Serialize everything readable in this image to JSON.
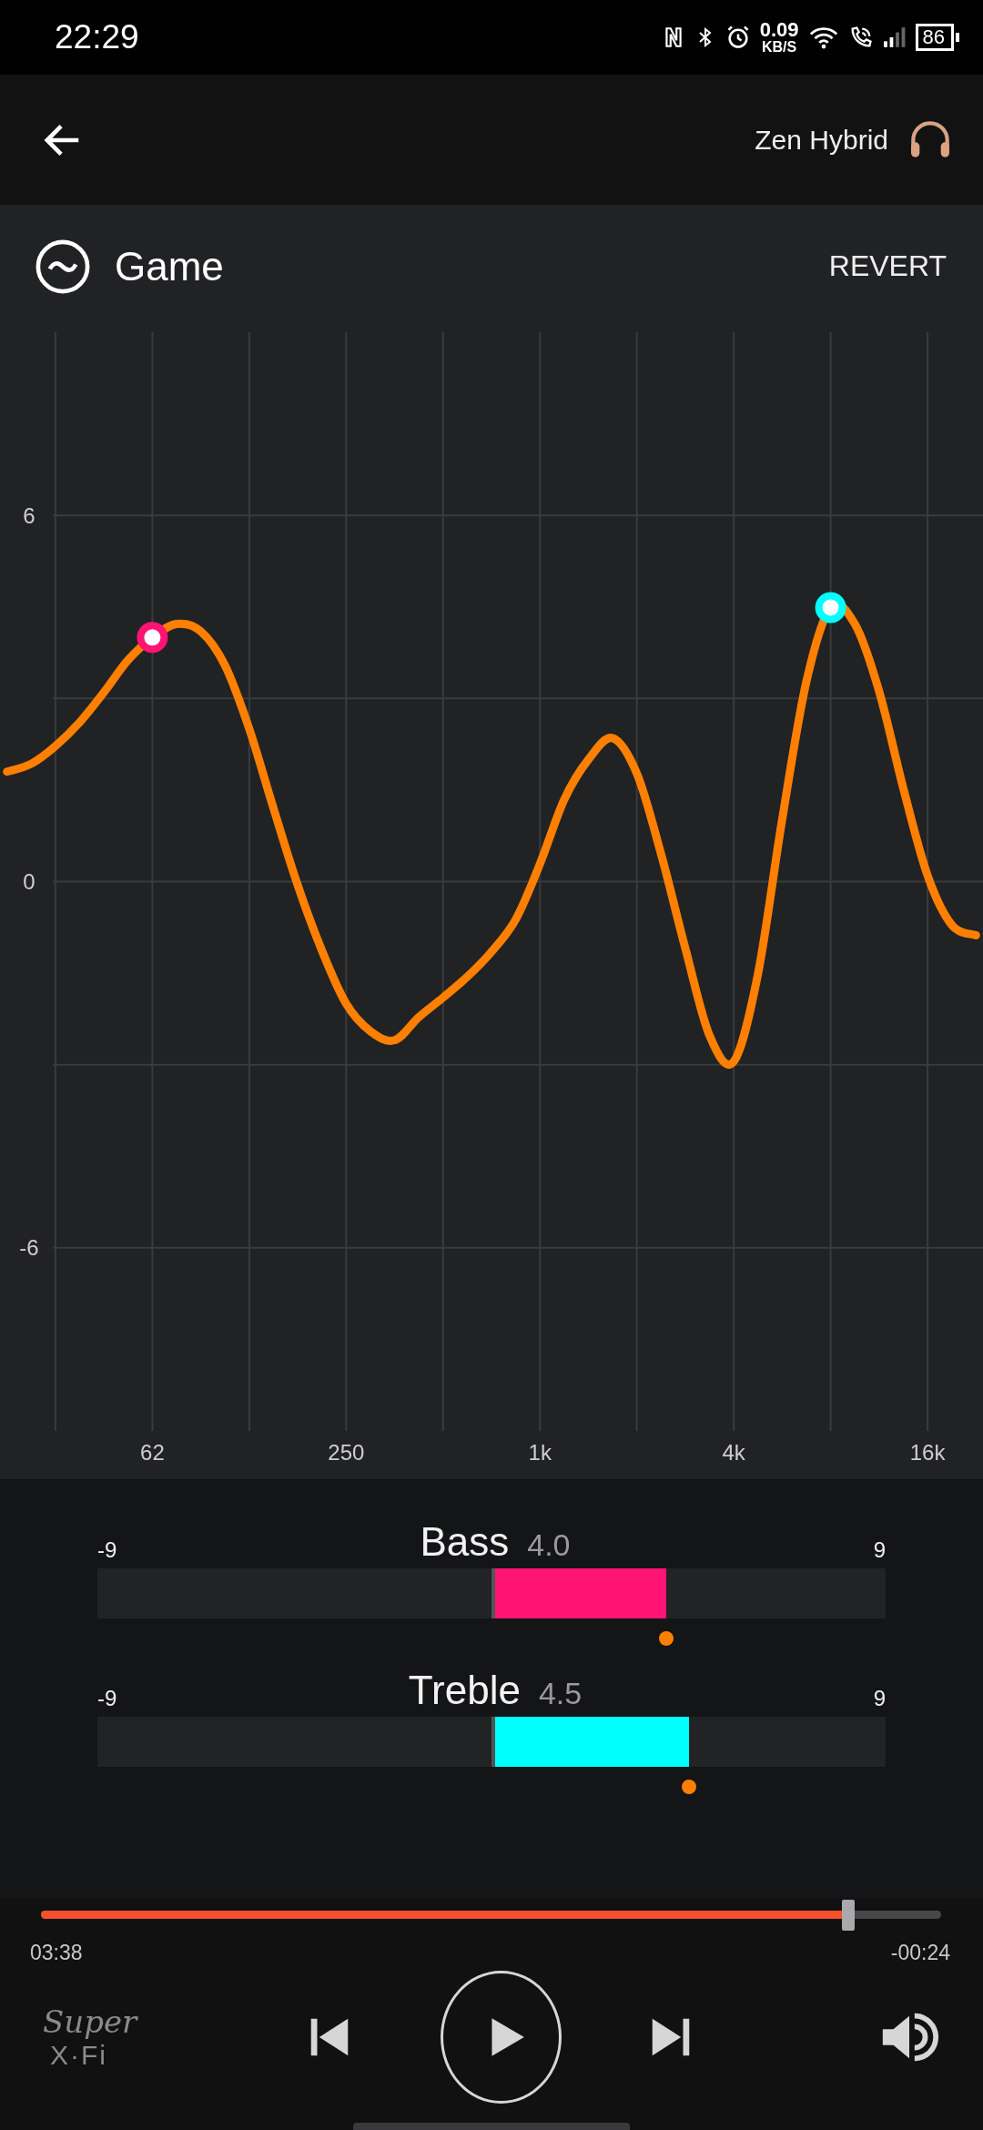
{
  "status_bar": {
    "time": "22:29",
    "net_speed": "0.09",
    "net_unit": "KB/S",
    "battery": "86"
  },
  "header": {
    "device": "Zen Hybrid"
  },
  "preset": {
    "name": "Game",
    "action": "REVERT"
  },
  "eq": {
    "chart_data": {
      "type": "line",
      "categories": [
        null,
        null,
        null,
        null,
        null,
        null,
        "62",
        null,
        null,
        null,
        null,
        null,
        null,
        null,
        "250",
        null,
        null,
        null,
        null,
        null,
        null,
        null,
        "1k",
        null,
        null,
        null,
        null,
        null,
        null,
        null,
        "4k",
        null,
        null,
        null,
        null,
        null,
        null,
        null,
        "16k",
        null,
        null
      ],
      "series": [
        {
          "color": "#ff7f00",
          "values": [
            1.8,
            1.93,
            2.22,
            2.61,
            3.1,
            3.63,
            4.0,
            4.22,
            4.1,
            3.54,
            2.5,
            1.2,
            -0.06,
            -1.13,
            -2.0,
            -2.45,
            -2.6,
            -2.22,
            -1.9,
            -1.56,
            -1.15,
            -0.62,
            0.29,
            1.34,
            2.0,
            2.35,
            1.77,
            0.45,
            -1.09,
            -2.52,
            -2.95,
            -1.51,
            1.02,
            3.28,
            4.49,
            4.22,
            3.12,
            1.53,
            0.1,
            -0.71,
            -0.88
          ]
        }
      ],
      "ylim": [
        -9,
        9
      ],
      "grid": true,
      "yticks": [
        6,
        0,
        -6
      ]
    }
  },
  "sliders": [
    {
      "label": "Bass",
      "reading": "4.0",
      "min_label": "-9",
      "max_label": "9",
      "level": 0.722,
      "color": "#ff1473"
    },
    {
      "label": "Treble",
      "reading": "4.5",
      "min_label": "-9",
      "max_label": "9",
      "level": 0.75,
      "color": "#00ffff"
    }
  ],
  "logo": {
    "line1": "Super",
    "line2": "X·Fi"
  },
  "player": {
    "elapsed": "03:38",
    "remaining": "-00:24",
    "level": 0.897
  }
}
